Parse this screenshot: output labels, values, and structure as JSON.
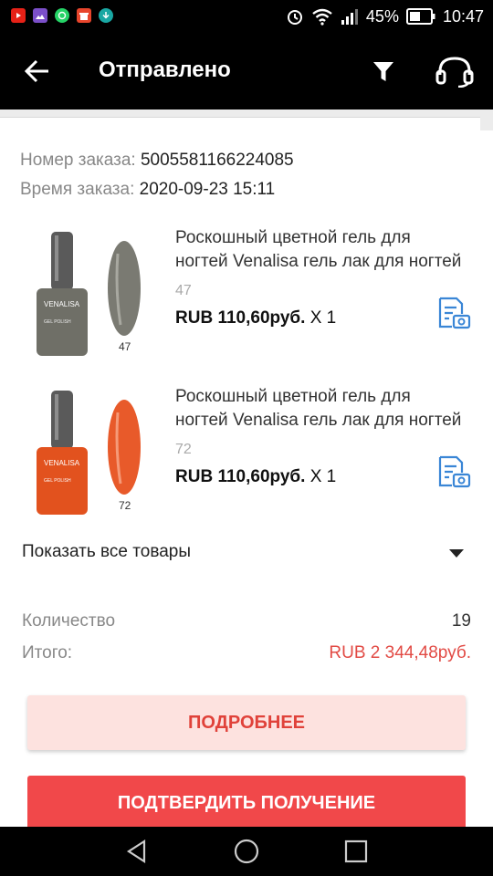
{
  "status_bar": {
    "battery_percent": "45%",
    "time": "10:47",
    "app_icons": [
      "youtube-icon",
      "gallery-icon",
      "whatsapp-icon",
      "gift-icon",
      "download-icon"
    ]
  },
  "header": {
    "title": "Отправлено"
  },
  "order": {
    "number_label": "Номер заказа:",
    "number_value": "5005581166224085",
    "time_label": "Время заказа:",
    "time_value": "2020-09-23 15:11"
  },
  "products": [
    {
      "name_line1": "Роскошный цветной гель для",
      "name_line2": "ногтей Venalisa гель лак для ногтей",
      "variant": "47",
      "price": "RUB 110,60руб.",
      "qty": "X 1",
      "image_label": "47",
      "bottle_color": "#6f6f67",
      "nail_color": "#7a7a72"
    },
    {
      "name_line1": "Роскошный цветной гель для",
      "name_line2": "ногтей Venalisa гель лак для ногтей",
      "variant": "72",
      "price": "RUB 110,60руб.",
      "qty": "X 1",
      "image_label": "72",
      "bottle_color": "#e2521e",
      "nail_color": "#e85a2a"
    }
  ],
  "show_all": {
    "label": "Показать все товары"
  },
  "summary": {
    "quantity_label": "Количество",
    "quantity_value": "19",
    "total_label": "Итого:",
    "total_value": "RUB 2 344,48руб."
  },
  "buttons": {
    "details": "ПОДРОБНЕЕ",
    "confirm": "ПОДТВЕРДИТЬ ПОЛУЧЕНИЕ"
  },
  "colors": {
    "accent_red": "#f1484a",
    "total_red": "#e24b45",
    "light_button_bg": "#fde2df",
    "icon_blue": "#3a86d6"
  }
}
